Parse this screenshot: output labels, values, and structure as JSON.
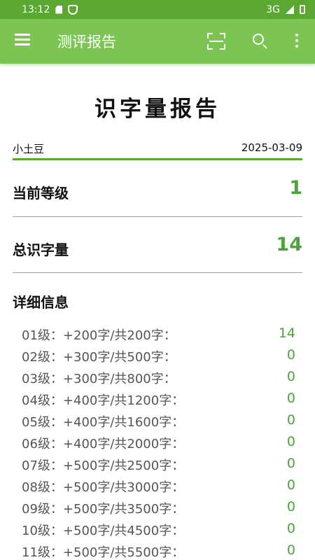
{
  "status_bar": {
    "time": "13:12",
    "network": "3G",
    "icons": [
      "sd-card-icon",
      "shield-icon",
      "signal-icon",
      "battery-icon"
    ]
  },
  "app_bar": {
    "title": "测评报告",
    "icons": [
      "menu-icon",
      "scan-icon",
      "search-icon",
      "more-vertical-icon"
    ],
    "background_color": "#7cc552"
  },
  "report": {
    "title": "识字量报告",
    "user_name": "小土豆",
    "date": "2025-03-09",
    "current_level_label": "当前等级",
    "current_level_value": "1",
    "total_label": "总识字量",
    "total_value": "14",
    "details_heading": "详细信息",
    "accent_color": "#4aa43a"
  },
  "levels": [
    {
      "label": "01级：+200字/共200字：",
      "count": "14"
    },
    {
      "label": "02级：+300字/共500字：",
      "count": "0"
    },
    {
      "label": "03级：+300字/共800字：",
      "count": "0"
    },
    {
      "label": "04级：+400字/共1200字：",
      "count": "0"
    },
    {
      "label": "05级：+400字/共1600字：",
      "count": "0"
    },
    {
      "label": "06级：+400字/共2000字：",
      "count": "0"
    },
    {
      "label": "07级：+500字/共2500字：",
      "count": "0"
    },
    {
      "label": "08级：+500字/共3000字：",
      "count": "0"
    },
    {
      "label": "09级：+500字/共3500字：",
      "count": "0"
    },
    {
      "label": "10级：+500字/共4500字：",
      "count": "0"
    },
    {
      "label": "11级：+500字/共5500字：",
      "count": "0"
    }
  ]
}
